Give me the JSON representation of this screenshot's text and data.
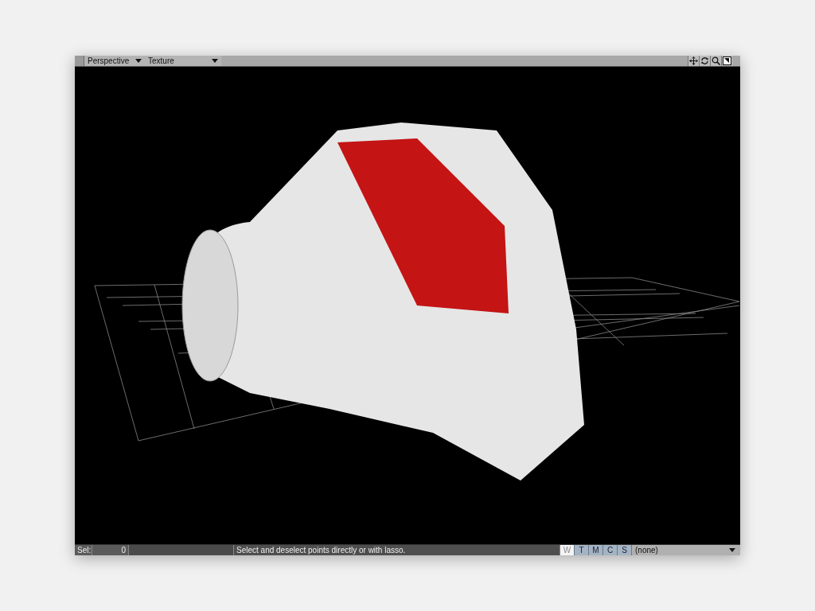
{
  "viewport": {
    "view_mode": "Perspective",
    "render_mode": "Texture"
  },
  "status_bar": {
    "sel_label": "Sel:",
    "sel_count": "0",
    "message": "Select and deselect points directly or with lasso.",
    "modes": [
      {
        "label": "W",
        "selected": true
      },
      {
        "label": "T",
        "selected": false
      },
      {
        "label": "M",
        "selected": false
      },
      {
        "label": "C",
        "selected": false
      },
      {
        "label": "S",
        "selected": false
      }
    ],
    "map": "(none)"
  }
}
